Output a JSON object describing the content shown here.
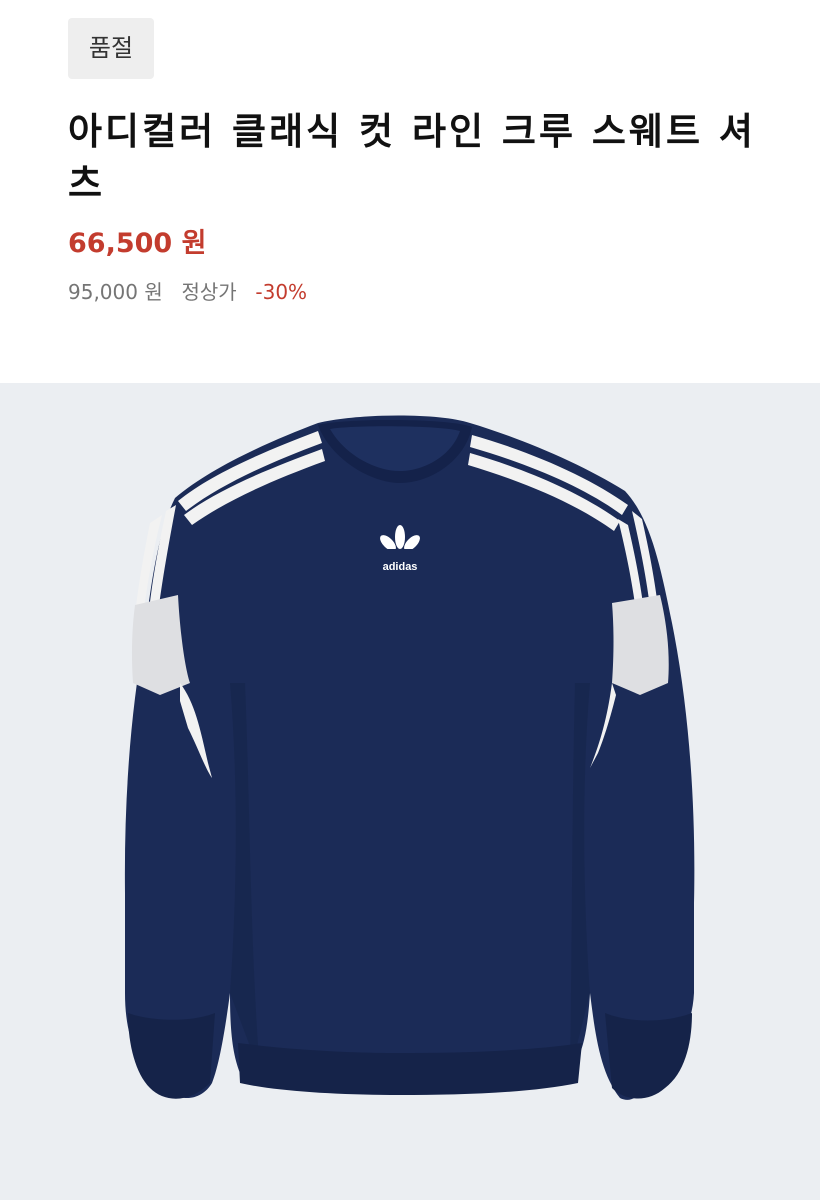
{
  "product": {
    "badge": "품절",
    "title": "아디컬러 클래식 컷 라인 크루 스웨트 셔츠",
    "price": "66,500 원",
    "original_price": "95,000 원",
    "original_price_label": "정상가",
    "discount": "-30%",
    "image": {
      "logo_text": "adidas",
      "icon": "sweatshirt-image"
    }
  },
  "colors": {
    "price_red": "#c33c2e",
    "badge_bg": "#eeeeee",
    "image_bg": "#ebeef2",
    "navy": "#1a2b57",
    "stripe_white": "#f2f2f2"
  }
}
